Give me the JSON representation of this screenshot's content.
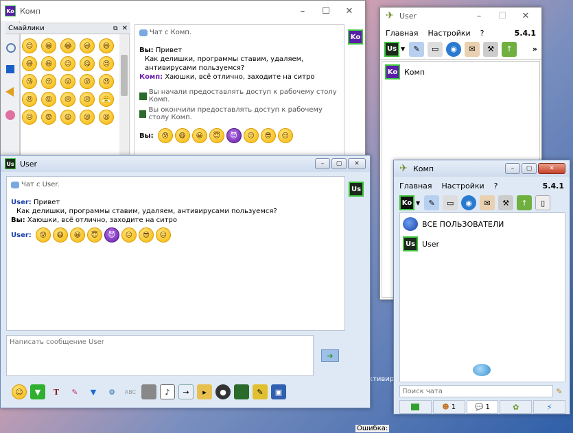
{
  "taskbar_fragments": {
    "vivir": "ктивир",
    "error_label": "Ошибка:"
  },
  "komp_chat_window": {
    "title": "Комп",
    "avatar": "Ko",
    "smileys_panel": {
      "title": "Смайлики"
    },
    "chat_header": "Чат с Комп.",
    "messages": [
      {
        "from": "Вы:",
        "text": "Привет"
      },
      {
        "from": "",
        "text": "Как делишки, программы ставим, удаляем, антивирусами пользуемся?"
      },
      {
        "from": "Комп:",
        "text": "Хаюшки, всё отлично, заходите на ситро"
      }
    ],
    "sys1": "Вы начали предоставлять доступ к рабочему столу Комп.",
    "sys2": "Вы окончили предоставлять доступ к рабочему столу Комп.",
    "last_from": "Вы:"
  },
  "user_chat_window": {
    "title": "User",
    "avatar": "Us",
    "chat_header": "Чат с User.",
    "messages": [
      {
        "from": "User:",
        "text": "Привет"
      },
      {
        "from": "",
        "text": "Как делишки, программы ставим, удаляем, антивирусами пользуемся?"
      },
      {
        "from": "Вы:",
        "text": "Хаюшки, всё отлично, заходите на ситро"
      }
    ],
    "last_from": "User:",
    "input_placeholder": "Написать сообщение User"
  },
  "user_main_window": {
    "title": "User",
    "menu": [
      "Главная",
      "Настройки",
      "?"
    ],
    "version": "5.4.1",
    "status_avatar": "Us",
    "contact": {
      "avatar": "Ko",
      "name": "Комп"
    },
    "more": "»"
  },
  "komp_main_window": {
    "title": "Комп",
    "menu": [
      "Главная",
      "Настройки",
      "?"
    ],
    "version": "5.4.1",
    "status_avatar": "Ko",
    "contacts": [
      {
        "name": "ВСЕ ПОЛЬЗОВАТЕЛИ"
      },
      {
        "avatar": "Us",
        "name": "User"
      }
    ],
    "search_placeholder": "Поиск чата",
    "tab_counts": [
      "1",
      "1"
    ]
  }
}
